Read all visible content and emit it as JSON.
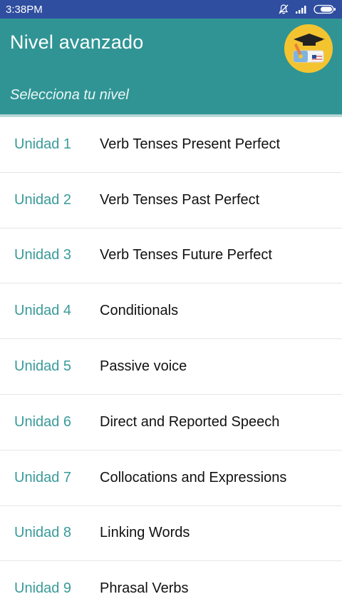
{
  "status_bar": {
    "time": "3:38PM",
    "icons": [
      "mute-bell-icon",
      "signal-icon",
      "battery-icon"
    ]
  },
  "app_bar": {
    "title": "Nivel avanzado",
    "subtitle": "Selecciona tu nivel",
    "logo": "graduation-cap-diploma-logo",
    "color": "#319494"
  },
  "colors": {
    "status_bar": "#2f4ea0",
    "unit_label": "#3a9a9a",
    "unit_title": "#111111"
  },
  "units": [
    {
      "label": "Unidad 1",
      "title": "Verb Tenses Present Perfect"
    },
    {
      "label": "Unidad 2",
      "title": "Verb Tenses Past Perfect"
    },
    {
      "label": "Unidad 3",
      "title": "Verb Tenses Future Perfect"
    },
    {
      "label": "Unidad 4",
      "title": "Conditionals"
    },
    {
      "label": "Unidad 5",
      "title": "Passive voice"
    },
    {
      "label": "Unidad 6",
      "title": "Direct and Reported Speech"
    },
    {
      "label": "Unidad 7",
      "title": "Collocations and Expressions"
    },
    {
      "label": "Unidad 8",
      "title": "Linking Words"
    },
    {
      "label": "Unidad 9",
      "title": "Phrasal Verbs"
    }
  ]
}
